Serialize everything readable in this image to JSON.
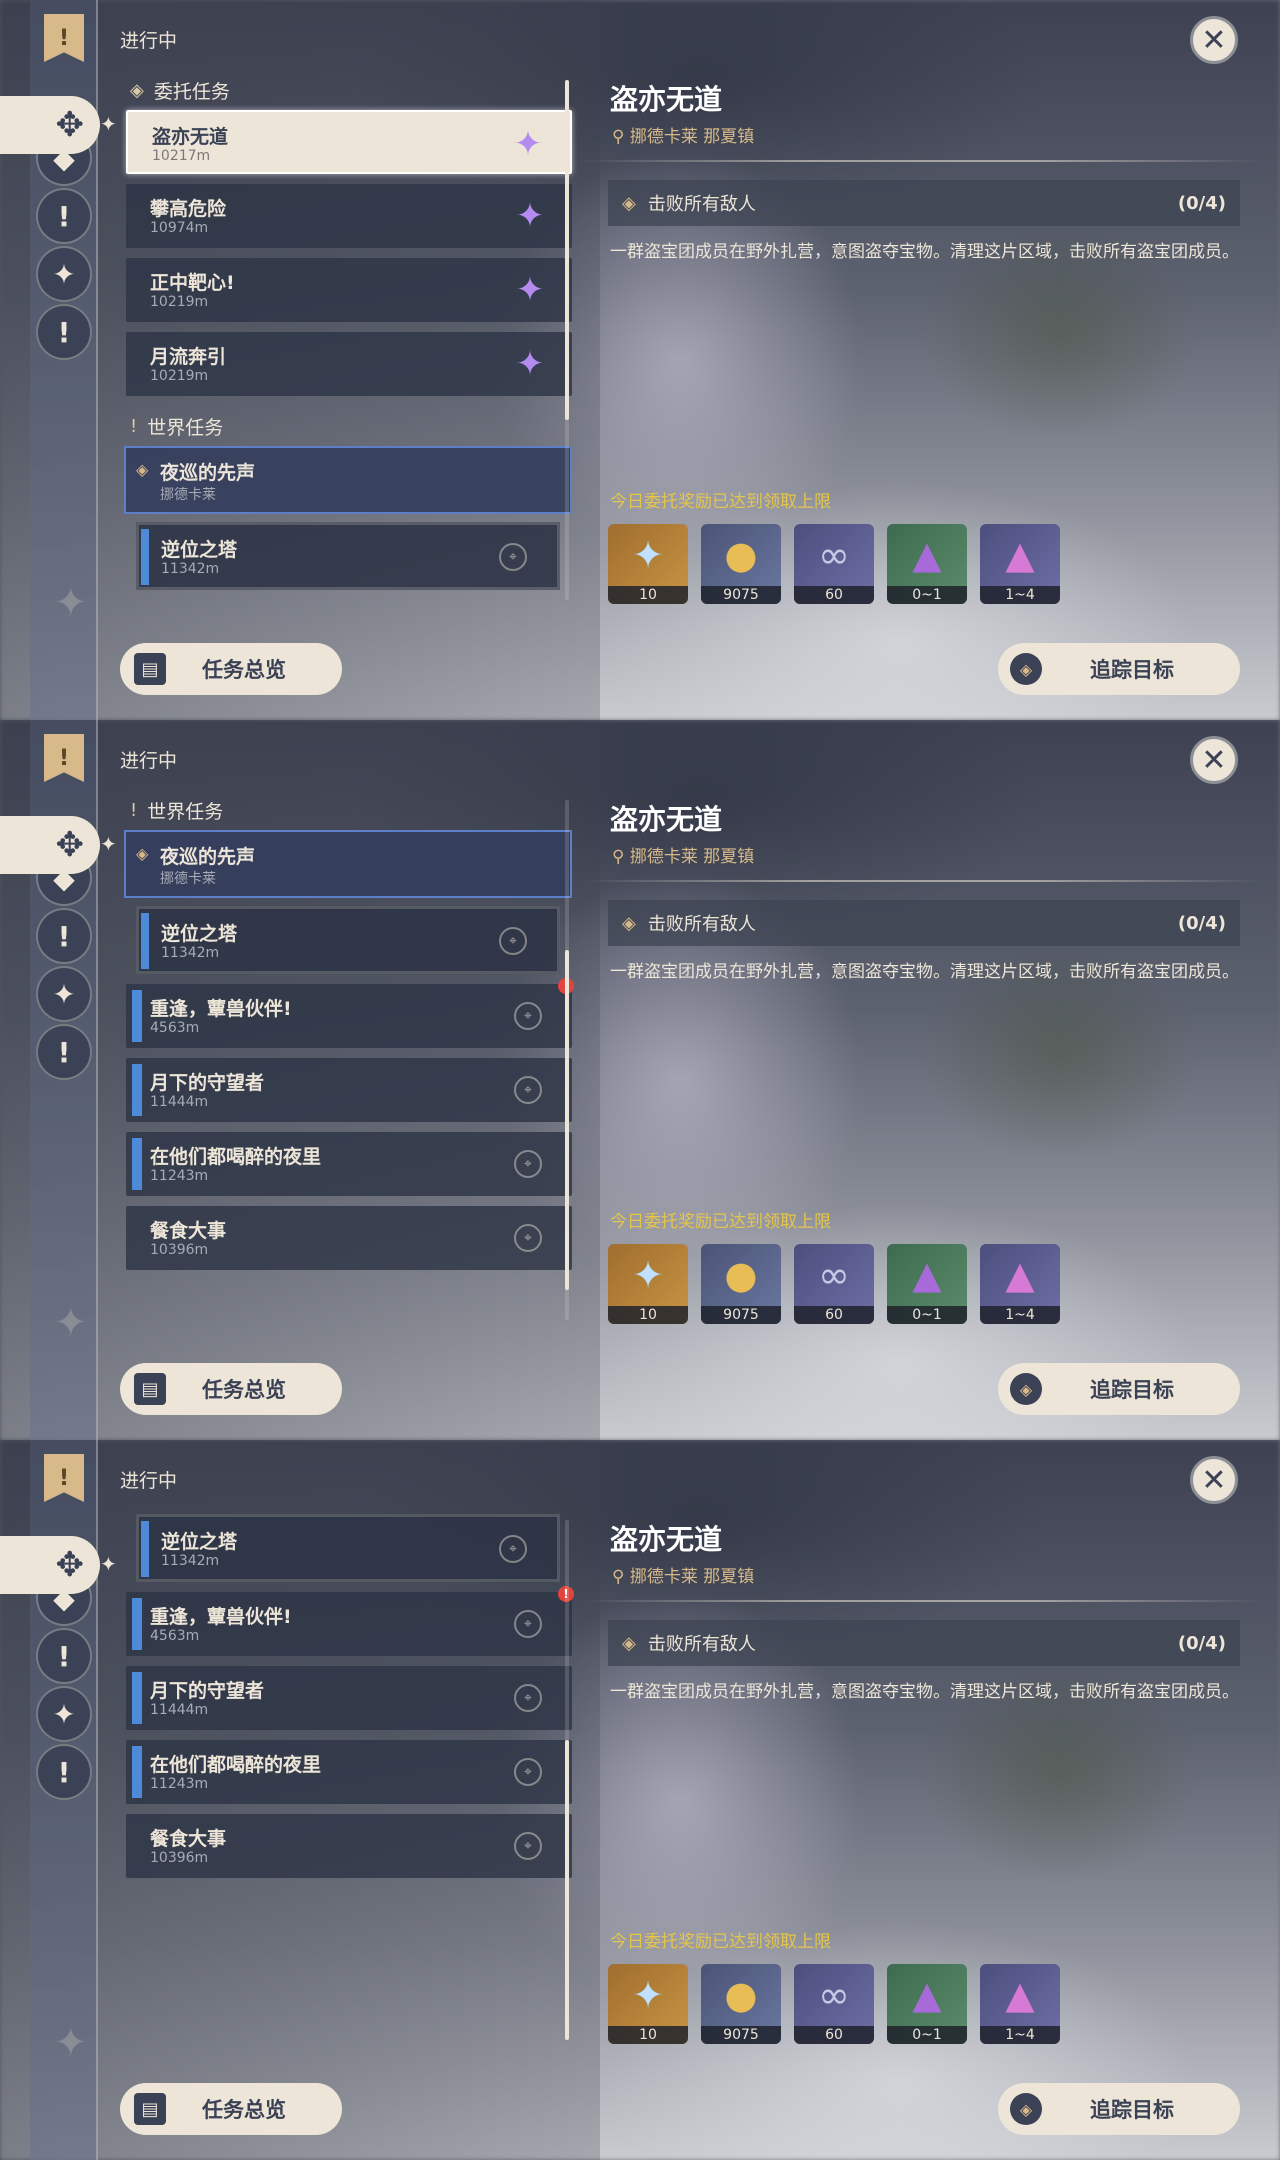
{
  "header_label": "进行中",
  "close_icon": "close-icon",
  "sections": {
    "commission": "委托任务",
    "world": "世界任务"
  },
  "commissions": [
    {
      "name": "盗亦无道",
      "dist": "10217m",
      "selected": true
    },
    {
      "name": "攀高危险",
      "dist": "10974m"
    },
    {
      "name": "正中靶心!",
      "dist": "10219m"
    },
    {
      "name": "月流奔引",
      "dist": "10219m"
    }
  ],
  "world_quest": {
    "name": "夜巡的先声",
    "region": "挪德卡莱"
  },
  "world_sub": {
    "name": "逆位之塔",
    "dist": "11342m"
  },
  "other_quests": [
    {
      "name": "重逢，蕈兽伙伴!",
      "dist": "4563m",
      "alert": "!"
    },
    {
      "name": "月下的守望者",
      "dist": "11444m"
    },
    {
      "name": "在他们都喝醉的夜里",
      "dist": "11243m"
    },
    {
      "name": "餐食大事",
      "dist": "10396m"
    }
  ],
  "detail": {
    "title": "盗亦无道",
    "location": "挪德卡莱 那夏镇",
    "objective": "击败所有敌人",
    "progress": "(0/4)",
    "description": "一群盗宝团成员在野外扎营，意图盗夺宝物。清理这片区域，击败所有盗宝团成员。",
    "reward_note": "今日委托奖励已达到领取上限",
    "rewards": [
      {
        "icon": "primogem-icon",
        "count": "10"
      },
      {
        "icon": "mora-icon",
        "count": "9075"
      },
      {
        "icon": "adventure-exp-icon",
        "count": "60"
      },
      {
        "icon": "crystal-ore-icon",
        "count": "0~1"
      },
      {
        "icon": "amethyst-icon",
        "count": "1~4"
      }
    ]
  },
  "buttons": {
    "overview": "任务总览",
    "track": "追踪目标"
  }
}
